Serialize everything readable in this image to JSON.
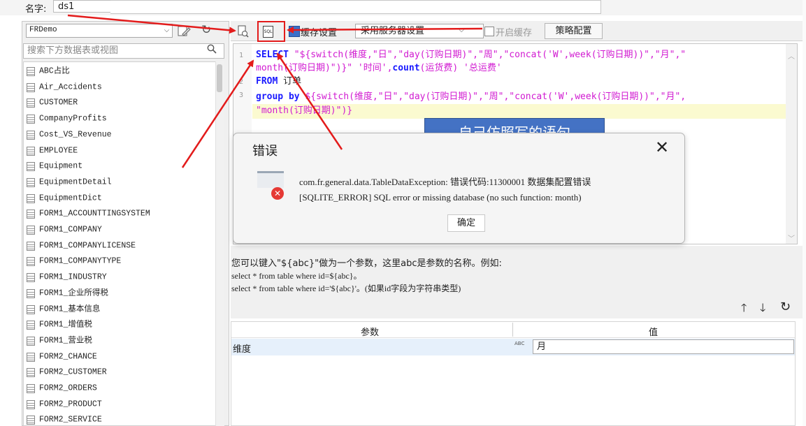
{
  "name_row": {
    "label": "名字:",
    "value": "ds1"
  },
  "left": {
    "datasource": "FRDemo",
    "search_placeholder": "搜索下方数据表或视图",
    "tables": [
      "ABC占比",
      "Air_Accidents",
      "CUSTOMER",
      "CompanyProfits",
      "Cost_VS_Revenue",
      "EMPLOYEE",
      "Equipment",
      "EquipmentDetail",
      "EquipmentDict",
      "FORM1_ACCOUNTTINGSYSTEM",
      "FORM1_COMPANY",
      "FORM1_COMPANYLICENSE",
      "FORM1_COMPANYTYPE",
      "FORM1_INDUSTRY",
      "FORM1_企业所得税",
      "FORM1_基本信息",
      "FORM1_增值税",
      "FORM1_营业税",
      "FORM2_CHANCE",
      "FORM2_CUSTOMER",
      "FORM2_ORDERS",
      "FORM2_PRODUCT",
      "FORM2_SERVICE"
    ]
  },
  "toolbar": {
    "cache_label": "缓存设置",
    "server_select": "采用服务器设置",
    "enable_cache": "开启缓存",
    "strategy_button": "策略配置"
  },
  "editor": {
    "line_numbers": [
      "1",
      "2",
      "3"
    ],
    "line1a_kw": "SELECT",
    "line1a_rest": " \"${switch(维度,\"日\",\"day(订购日期)\",\"周\",\"concat('W',week(订购日期))\",\"月\",\"",
    "line1b_str": "month(订购日期)\")}\" '时间',",
    "line1b_kw": "count",
    "line1b_rest": "(运货费) '总运费'",
    "line2_kw": "FROM",
    "line2_rest": " 订单",
    "line3_kw": "group by",
    "line3_rest": " ${switch(维度,\"日\",\"day(订购日期)\",\"周\",\"concat('W',week(订购日期))\",\"月\",",
    "line4_str": "\"month(订购日期)\")}"
  },
  "annotation": "自己仿照写的语句",
  "error_dialog": {
    "title": "错误",
    "message_line1": "com.fr.general.data.TableDataException: 错误代码:11300001 数据集配置错误",
    "message_line2": "[SQLITE_ERROR] SQL error or missing database (no such function: month)",
    "confirm": "确定"
  },
  "help": {
    "line1": "您可以键入\"${abc}\"做为一个参数，这里abc是参数的名称。例如:",
    "line2": "select * from table where id=${abc}。",
    "line3": "select * from table where id='${abc}'。(如果id字段为字符串类型)"
  },
  "params": {
    "col_name": "参数",
    "col_value": "值",
    "rows": [
      {
        "name": "维度",
        "type_icon": "ABC",
        "value": "月"
      }
    ]
  },
  "colors": {
    "highlight_box": "#e31b1b",
    "annotation_bg": "#4472c4",
    "arrow": "#e31b1b",
    "keyword": "#1a1aff",
    "string": "#d11ad1"
  }
}
